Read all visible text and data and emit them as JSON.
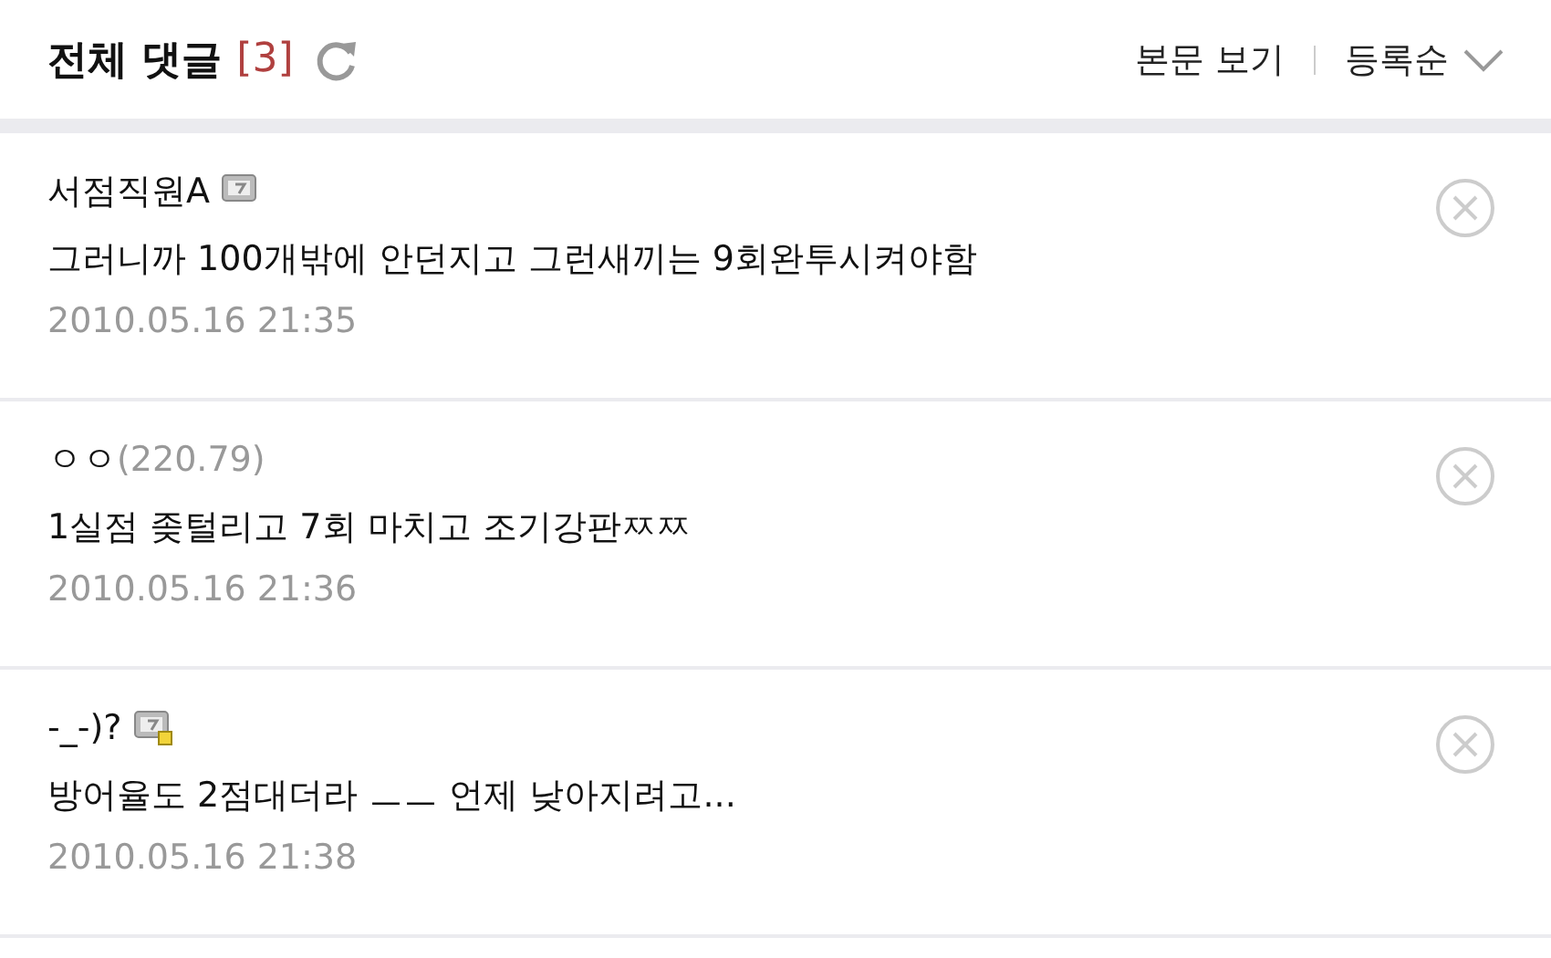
{
  "header": {
    "title": "전체 댓글",
    "count": "[3]",
    "view_post": "본문 보기",
    "sort": "등록순"
  },
  "comments": [
    {
      "author": "서점직원A",
      "badge": true,
      "badge_dot": false,
      "text": "그러니까 100개밖에 안던지고 그런새끼는 9회완투시켜야함",
      "date": "2010.05.16 21:35"
    },
    {
      "author": "ㅇㅇ",
      "ip": "(220.79)",
      "badge": false,
      "text": "1실점 좆털리고 7회 마치고 조기강판ㅉㅉ",
      "date": "2010.05.16 21:36"
    },
    {
      "author": "-_-)?",
      "badge": true,
      "badge_dot": true,
      "text": "방어율도 2점대더라 ㅡㅡ 언제 낮아지려고...",
      "date": "2010.05.16 21:38"
    }
  ]
}
